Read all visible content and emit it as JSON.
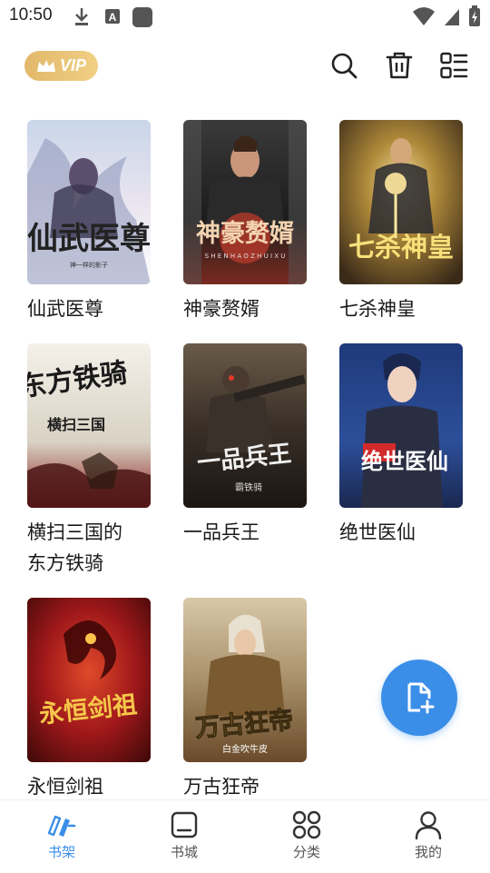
{
  "status_bar": {
    "time": "10:50"
  },
  "header": {
    "vip_label": "VIP"
  },
  "books": [
    {
      "title": "仙武医尊",
      "cover_text": "仙武医尊",
      "cover_subtext": "神一样的影子"
    },
    {
      "title": "神豪赘婿",
      "cover_text": "神豪赘婿",
      "cover_subtext": "S  H  E  N  H  A  O  Z  H  U  I  X  U"
    },
    {
      "title": "七杀神皇",
      "cover_text": "七杀神皇",
      "cover_subtext": ""
    },
    {
      "title": "横扫三国的东方铁骑",
      "cover_text": "东方铁骑",
      "cover_subtext": "横扫三国"
    },
    {
      "title": "一品兵王",
      "cover_text": "一品兵王",
      "cover_subtext": "霸铁骑"
    },
    {
      "title": "绝世医仙",
      "cover_text": "绝世医仙",
      "cover_subtext": ""
    },
    {
      "title": "永恒剑祖",
      "cover_text": "永恒剑祖",
      "cover_subtext": ""
    },
    {
      "title": "万古狂帝",
      "cover_text": "万古狂帝",
      "cover_subtext": "白金吹牛皮"
    }
  ],
  "bottom_nav": [
    {
      "label": "书架",
      "icon": "bookshelf-icon",
      "active": true
    },
    {
      "label": "书城",
      "icon": "bookstore-icon",
      "active": false
    },
    {
      "label": "分类",
      "icon": "category-icon",
      "active": false
    },
    {
      "label": "我的",
      "icon": "profile-icon",
      "active": false
    }
  ],
  "colors": {
    "accent": "#3a8ee8",
    "vip_gold": "#e2b86a"
  }
}
